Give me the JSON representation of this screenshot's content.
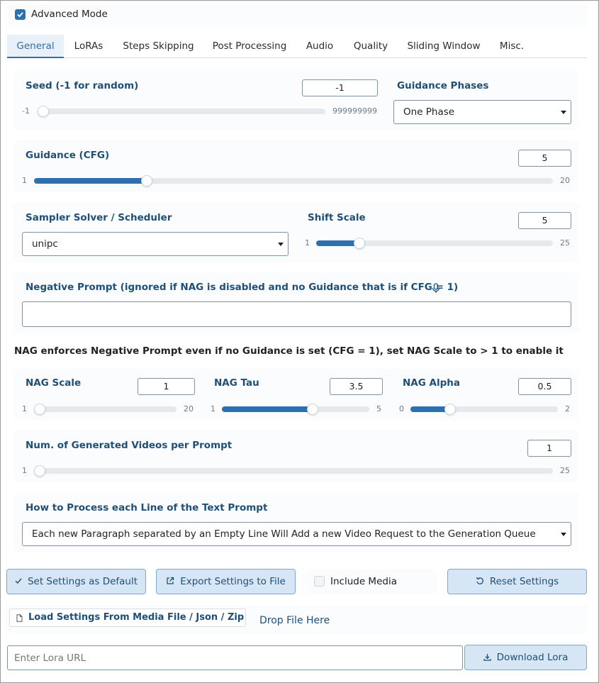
{
  "advanced_mode": {
    "label": "Advanced Mode",
    "checked": true
  },
  "tabs": [
    {
      "label": "General",
      "active": true
    },
    {
      "label": "LoRAs"
    },
    {
      "label": "Steps Skipping"
    },
    {
      "label": "Post Processing"
    },
    {
      "label": "Audio"
    },
    {
      "label": "Quality"
    },
    {
      "label": "Sliding Window"
    },
    {
      "label": "Misc."
    }
  ],
  "seed": {
    "title": "Seed (-1 for random)",
    "value": "-1",
    "min": "-1",
    "max": "999999999",
    "fraction": 0.0
  },
  "guidance_phases": {
    "title": "Guidance Phases",
    "selected": "One Phase"
  },
  "guidance_cfg": {
    "title": "Guidance (CFG)",
    "value": "5",
    "min": "1",
    "max": "20",
    "fraction": 0.2105
  },
  "sampler": {
    "title": "Sampler Solver / Scheduler",
    "selected": "unipc"
  },
  "shift_scale": {
    "title": "Shift Scale",
    "value": "5",
    "min": "1",
    "max": "25",
    "fraction": 0.1667
  },
  "negative_prompt": {
    "title": "Negative Prompt (ignored if NAG is disabled and no Guidance that is if CFG = 1)",
    "icon": "microphone-icon",
    "value": ""
  },
  "nag_note": "NAG enforces Negative Prompt even if no Guidance is set (CFG = 1), set NAG Scale to > 1 to enable it",
  "nag_scale": {
    "title": "NAG Scale",
    "value": "1",
    "min": "1",
    "max": "20",
    "fraction": 0.0
  },
  "nag_tau": {
    "title": "NAG Tau",
    "value": "3.5",
    "min": "1",
    "max": "5",
    "fraction": 0.625
  },
  "nag_alpha": {
    "title": "NAG Alpha",
    "value": "0.5",
    "min": "0",
    "max": "2",
    "fraction": 0.25
  },
  "num_videos": {
    "title": "Num. of Generated Videos per Prompt",
    "value": "1",
    "min": "1",
    "max": "25",
    "fraction": 0.0
  },
  "line_processing": {
    "title": "How to Process each Line of the Text Prompt",
    "selected": "Each new Paragraph separated by an Empty Line Will Add a new Video Request to the Generation Queue"
  },
  "buttons": {
    "set_default": "Set Settings as Default",
    "export": "Export Settings to File",
    "include_media": "Include Media",
    "reset": "Reset Settings"
  },
  "load_settings": {
    "label": "Load Settings From Media File / Json / Zip",
    "drop": "Drop File Here"
  },
  "lora_url": {
    "placeholder": "Enter Lora URL",
    "value": ""
  },
  "download_lora": "Download Lora",
  "colors": {
    "accent": "#2e6fb0",
    "title": "#1f4f77",
    "button_bg": "#d7e6f4"
  }
}
